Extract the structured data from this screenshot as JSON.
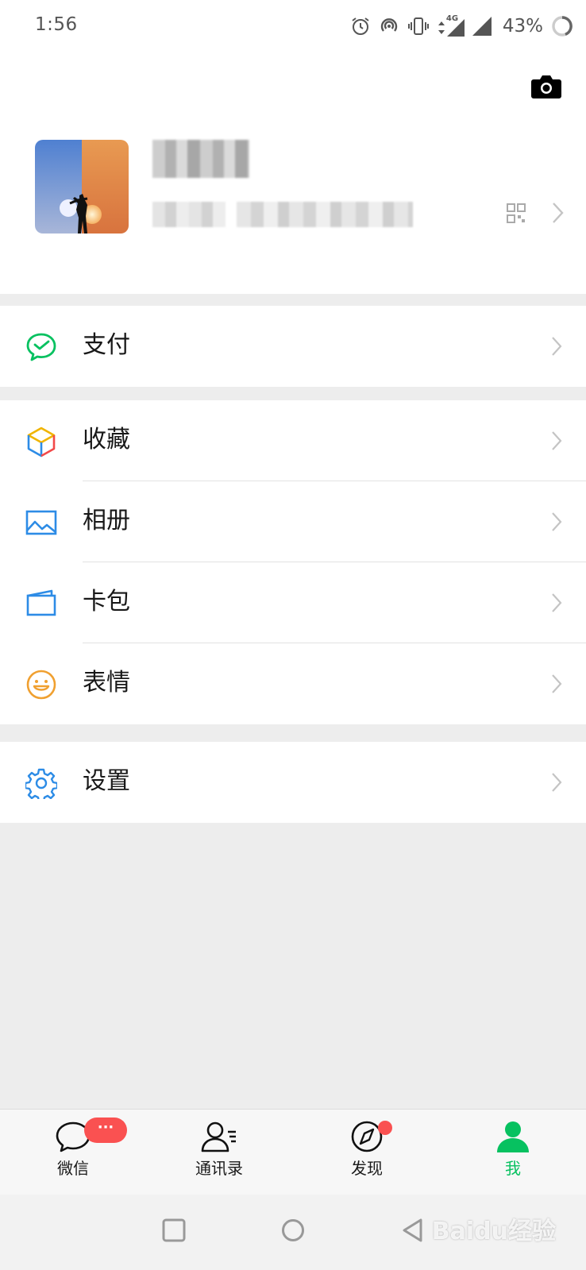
{
  "status_bar": {
    "time": "1:56",
    "network": "4G",
    "battery": "43%"
  },
  "menu": {
    "pay": "支付",
    "favorites": "收藏",
    "album": "相册",
    "cards": "卡包",
    "stickers": "表情",
    "settings": "设置"
  },
  "tabs": {
    "chats": "微信",
    "chats_badge": "···",
    "contacts": "通讯录",
    "discover": "发现",
    "me": "我"
  },
  "colors": {
    "accent": "#07c160",
    "badge": "#fa5151",
    "background": "#ededed"
  },
  "watermark": "Baidu经验"
}
